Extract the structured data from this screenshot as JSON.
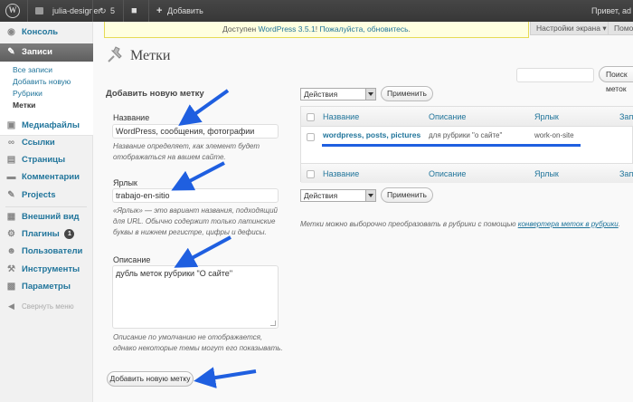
{
  "adminbar": {
    "site_name": "julia-designer",
    "updates_count": "5",
    "add_new": "Добавить",
    "greeting": "Привет, ad"
  },
  "sidebar": {
    "items": [
      {
        "label": "Консоль",
        "icon": "dashboard-icon"
      },
      {
        "label": "Записи",
        "icon": "pin-icon"
      },
      {
        "label": "Медиафайлы",
        "icon": "media-icon"
      },
      {
        "label": "Ссылки",
        "icon": "links-icon"
      },
      {
        "label": "Страницы",
        "icon": "pages-icon"
      },
      {
        "label": "Комментарии",
        "icon": "comments-icon"
      },
      {
        "label": "Projects",
        "icon": "pin-icon"
      },
      {
        "label": "Внешний вид",
        "icon": "appearance-icon"
      },
      {
        "label": "Плагины",
        "icon": "plugins-icon",
        "badge": "1"
      },
      {
        "label": "Пользователи",
        "icon": "users-icon"
      },
      {
        "label": "Инструменты",
        "icon": "tools-icon"
      },
      {
        "label": "Параметры",
        "icon": "settings-icon"
      },
      {
        "label": "Свернуть меню",
        "icon": "collapse-icon"
      }
    ],
    "submenu": [
      "Все записи",
      "Добавить новую",
      "Рубрики",
      "Метки"
    ]
  },
  "notice": {
    "text_before": "Доступен ",
    "link1": "WordPress 3.5.1",
    "text_mid": "! ",
    "link2": "Пожалуйста, обновитесь"
  },
  "screen_options": "Настройки экрана",
  "help_tab": "Помощь",
  "page_title": "Метки",
  "search_button": "Поиск меток",
  "form": {
    "title": "Добавить новую метку",
    "name_label": "Название",
    "name_value": "WordPress, сообщения, фотографии",
    "name_desc": "Название определяет, как элемент будет отображаться на вашем сайте.",
    "slug_label": "Ярлык",
    "slug_value": "trabajo-en-sitio",
    "slug_desc": "«Ярлык» — это вариант названия, подходящий для URL. Обычно содержит только латинские буквы в нижнем регистре, цифры и дефисы.",
    "desc_label": "Описание",
    "desc_value": "дубль меток рубрики \"О сайте\"",
    "desc_help": "Описание по умолчанию не отображается, однако некоторые темы могут его показывать.",
    "submit": "Добавить новую метку"
  },
  "bulk": {
    "select": "Действия",
    "apply": "Применить"
  },
  "table": {
    "columns": [
      "Название",
      "Описание",
      "Ярлык",
      "Запи"
    ],
    "rows": [
      {
        "name": "wordpress, posts, pictures",
        "description": "для рубрики \"о сайте\"",
        "slug": "work-on-site"
      }
    ]
  },
  "footer_note": {
    "text": "Метки можно выборочно преобразовать в рубрики с помощью ",
    "link": "конвертера меток в рубрики"
  },
  "colors": {
    "accent": "#21759b",
    "arrow": "#1f5fe0",
    "adminbar": "#464646"
  }
}
